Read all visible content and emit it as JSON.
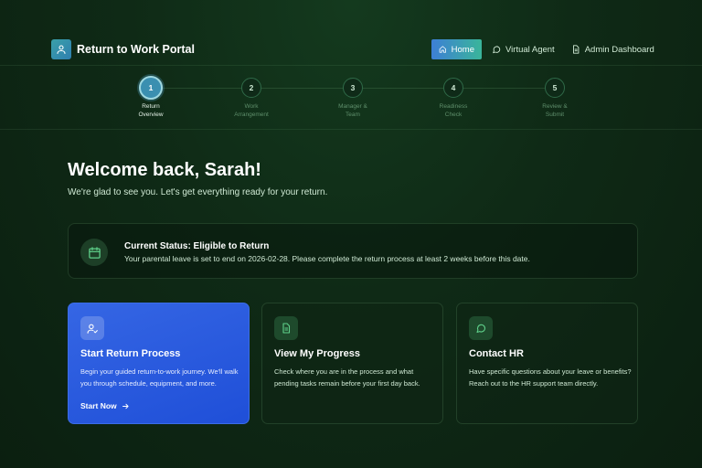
{
  "header": {
    "brand_title": "Return to Work Portal",
    "brand_icon": "user-icon",
    "nav": [
      {
        "label": "Home",
        "icon": "home-icon",
        "active": true
      },
      {
        "label": "Virtual Agent",
        "icon": "chat-bubble-icon",
        "active": false
      },
      {
        "label": "Admin Dashboard",
        "icon": "document-icon",
        "active": false
      }
    ]
  },
  "stepper": {
    "steps": [
      {
        "number": "1",
        "line1": "Return",
        "line2": "Overview",
        "active": true
      },
      {
        "number": "2",
        "line1": "Work",
        "line2": "Arrangement",
        "active": false
      },
      {
        "number": "3",
        "line1": "Manager &",
        "line2": "Team",
        "active": false
      },
      {
        "number": "4",
        "line1": "Readiness",
        "line2": "Check",
        "active": false
      },
      {
        "number": "5",
        "line1": "Review &",
        "line2": "Submit",
        "active": false
      }
    ]
  },
  "welcome": {
    "title": "Welcome back, Sarah!",
    "subtitle": "We're glad to see you. Let's get everything ready for your return."
  },
  "status": {
    "icon": "calendar-icon",
    "title": "Current Status: Eligible to Return",
    "text": "Your parental leave is set to end on 2026-02-28. Please complete the return process at least 2 weeks before this date."
  },
  "cards": [
    {
      "icon": "user-check-icon",
      "title": "Start Return Process",
      "text": "Begin your guided return-to-work journey. We'll walk you through schedule, equipment, and more.",
      "link": "Start Now"
    },
    {
      "icon": "document-icon",
      "title": "View My Progress",
      "text": "Check where you are in the process and what pending tasks remain before your first day back."
    },
    {
      "icon": "chat-bubble-icon",
      "title": "Contact HR",
      "text": "Have specific questions about your leave or benefits? Reach out to the HR support team directly."
    }
  ],
  "colors": {
    "background": "#0f2a16",
    "accent_blue": "#2456dc",
    "accent_teal": "#3ab59a",
    "active_step": "#3b8fb0"
  }
}
